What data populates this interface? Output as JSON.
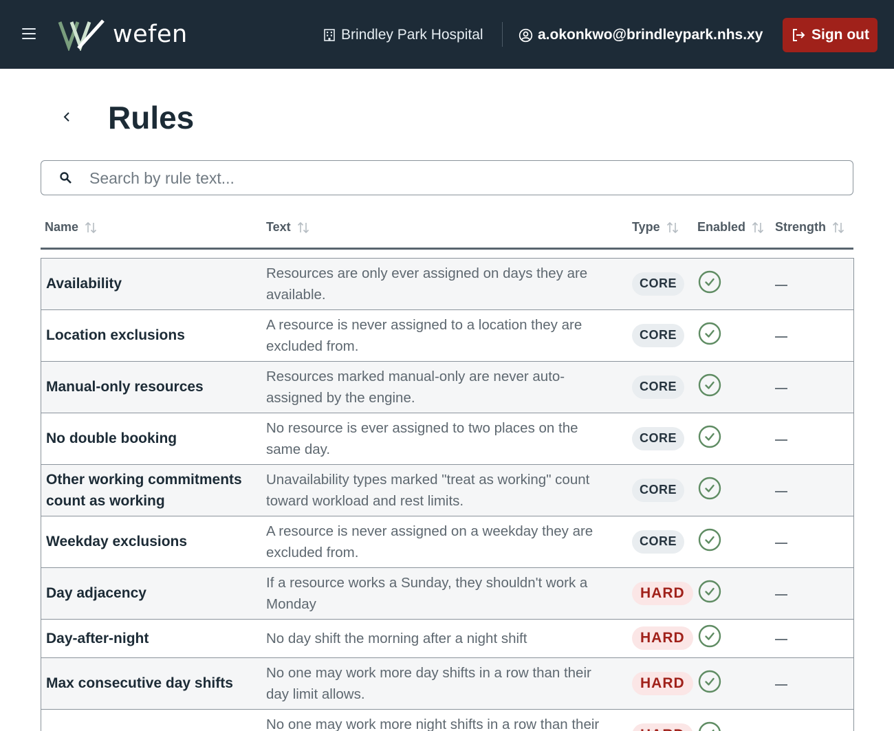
{
  "header": {
    "logo_text": "wefen",
    "organization": "Brindley Park Hospital",
    "user_email": "a.okonkwo@brindleypark.nhs.xy",
    "signout_label": "Sign out"
  },
  "page": {
    "title": "Rules"
  },
  "search": {
    "placeholder": "Search by rule text...",
    "value": ""
  },
  "table": {
    "columns": [
      {
        "label": "Name"
      },
      {
        "label": "Text"
      },
      {
        "label": "Type"
      },
      {
        "label": "Enabled"
      },
      {
        "label": "Strength"
      }
    ],
    "rows": [
      {
        "name": "Availability",
        "text": "Resources are only ever assigned on days they are available.",
        "type": "CORE",
        "enabled": true,
        "strength": "—"
      },
      {
        "name": "Location exclusions",
        "text": "A resource is never assigned to a location they are excluded from.",
        "type": "CORE",
        "enabled": true,
        "strength": "—"
      },
      {
        "name": "Manual-only resources",
        "text": "Resources marked manual-only are never auto-assigned by the engine.",
        "type": "CORE",
        "enabled": true,
        "strength": "—"
      },
      {
        "name": "No double booking",
        "text": "No resource is ever assigned to two places on the same day.",
        "type": "CORE",
        "enabled": true,
        "strength": "—"
      },
      {
        "name": "Other working commitments count as working",
        "text": "Unavailability types marked \"treat as working\" count toward workload and rest limits.",
        "type": "CORE",
        "enabled": true,
        "strength": "—"
      },
      {
        "name": "Weekday exclusions",
        "text": "A resource is never assigned on a weekday they are excluded from.",
        "type": "CORE",
        "enabled": true,
        "strength": "—"
      },
      {
        "name": "Day adjacency",
        "text": "If a resource works a Sunday, they shouldn't work a Monday",
        "type": "HARD",
        "enabled": true,
        "strength": "—"
      },
      {
        "name": "Day-after-night",
        "text": "No day shift the morning after a night shift",
        "type": "HARD",
        "enabled": true,
        "strength": "—"
      },
      {
        "name": "Max consecutive day shifts",
        "text": "No one may work more day shifts in a row than their day limit allows.",
        "type": "HARD",
        "enabled": true,
        "strength": "—"
      },
      {
        "name": "",
        "text": "No one may work more night shifts in a row than their",
        "type": "HARD",
        "enabled": true,
        "strength": "—"
      }
    ]
  }
}
